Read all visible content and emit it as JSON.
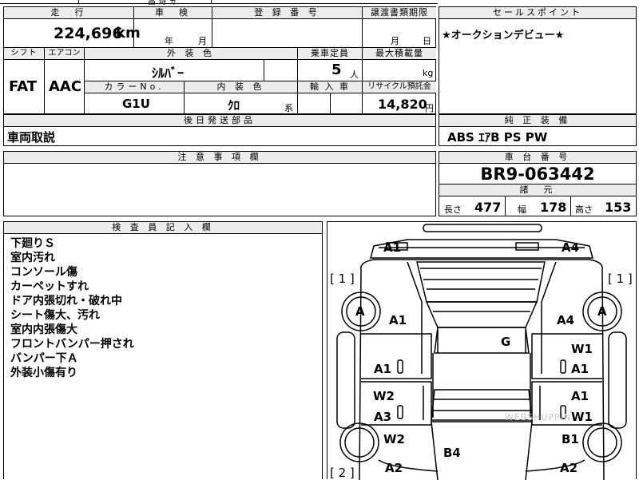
{
  "top_fragments": {
    "year_fragment": "昌 诗 ヵ"
  },
  "mileage": {
    "header": "走　行",
    "value": "224,696",
    "unit": "km"
  },
  "inspection": {
    "header": "車　検",
    "year_unit": "年",
    "month_unit": "月"
  },
  "registration": {
    "header": "登 録 番 号"
  },
  "transfer": {
    "header": "譲渡書類期限",
    "month_unit": "月",
    "day_unit": "日"
  },
  "sales_point": {
    "header": "セールスポイント",
    "text": "★オークションデビュー★"
  },
  "shift": {
    "header": "シフト",
    "value": "FAT"
  },
  "aircon": {
    "header": "エアコン",
    "value": "AAC"
  },
  "exterior_color": {
    "header": "外 装 色",
    "value": "ｼﾙﾊﾞｰ"
  },
  "capacity": {
    "header": "乗車定員",
    "value": "5",
    "unit": "人"
  },
  "max_load": {
    "header": "最大積載量",
    "unit": "kg"
  },
  "color_no": {
    "header": "カラーNo.",
    "value": "G1U"
  },
  "interior_color": {
    "header": "内 装 色",
    "value": "ｸﾛ",
    "unit": "系"
  },
  "import": {
    "header": "輸 入 車"
  },
  "recycle": {
    "header": "リサイクル預託金",
    "value": "14,820",
    "unit": "円"
  },
  "later_parts": {
    "header": "後日発送部品",
    "value": "車両取説"
  },
  "equipment": {
    "header": "純 正 装 備",
    "value": "ABS ｴｱB PS PW"
  },
  "caution": {
    "header": "注 意 事 項 欄"
  },
  "chassis": {
    "header": "車 台 番 号",
    "value": "BR9-063442"
  },
  "dimensions": {
    "header": "諸　元",
    "length_label": "長さ",
    "length": "477",
    "width_label": "幅",
    "width": "178",
    "height_label": "高さ",
    "height": "153"
  },
  "inspector": {
    "header": "検 査 員 記 入 欄",
    "notes": [
      "下廻りＳ",
      "室内汚れ",
      "コンソール傷",
      "カーペットすれ",
      "ドア内張切れ・破れ中",
      "シート傷大、汚れ",
      "室内内張傷大",
      "フロントバンパー押され",
      "バンパー下Ａ",
      "外装小傷有り"
    ]
  },
  "diagram": {
    "bracket_left_top": "[ 1 ]",
    "bracket_right_top": "[ 1 ]",
    "bracket_left_bottom": "[ 2 ]",
    "wheel_fl": "A",
    "wheel_fr": "A",
    "marks": {
      "front_left": "A1",
      "front_right": "A4",
      "fender_left": "A1",
      "fender_right": "A4",
      "roof": "G",
      "door_fl": "A1",
      "door_fr_top": "W1",
      "door_fr_bottom": "A1",
      "door_rl_top": "W2",
      "door_rl_bottom": "A3",
      "door_rr_top": "A1",
      "door_rr_bottom": "W1",
      "rear_qtr_left": "W2",
      "rear_qtr_right": "B1",
      "trunk": "B4",
      "rear_left": "A2",
      "rear_right": "A2"
    },
    "watermark": "WEBSHUPPIN"
  }
}
